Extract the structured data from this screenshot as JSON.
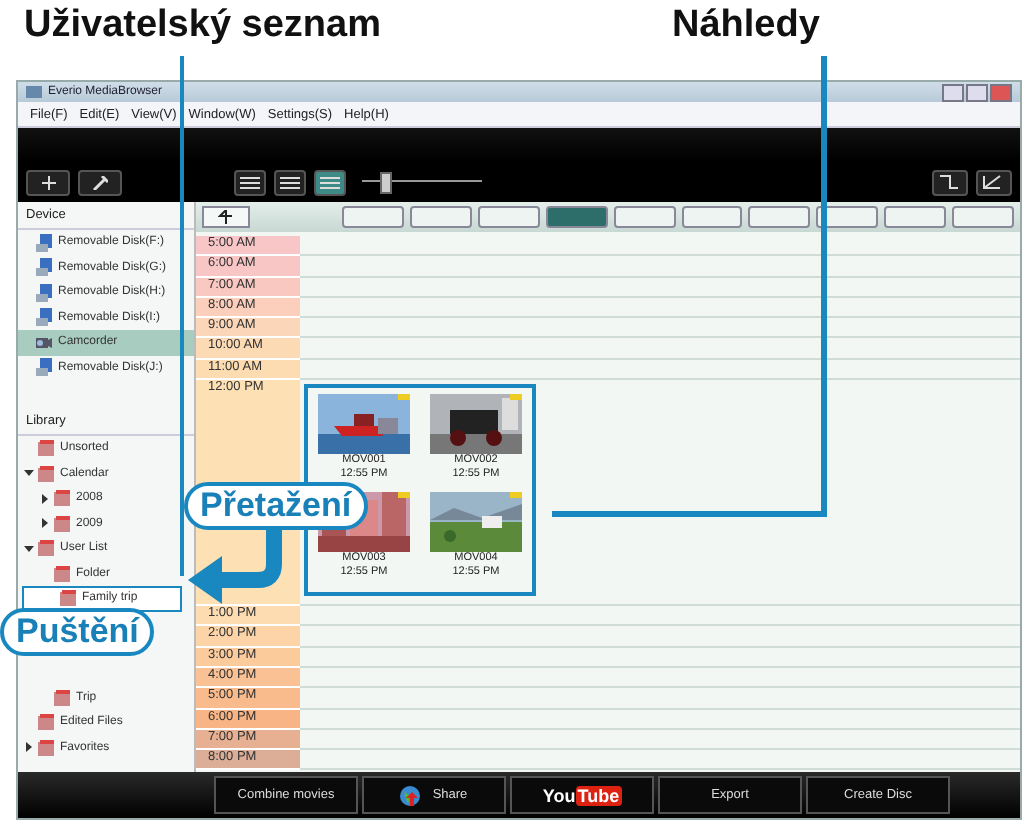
{
  "annotations": {
    "user_list_label": "Uživatelský seznam",
    "thumbnails_label": "Náhledy",
    "drag_label": "Přetažení",
    "drop_label": "Puštění"
  },
  "window": {
    "title": "Everio MediaBrowser"
  },
  "menu": [
    "File(F)",
    "Edit(E)",
    "View(V)",
    "Window(W)",
    "Settings(S)",
    "Help(H)"
  ],
  "view_modes": [
    {
      "selected": false
    },
    {
      "selected": false
    },
    {
      "selected": true
    }
  ],
  "zoom_slider": {
    "level": 0.15
  },
  "nav_buttons": [
    {
      "selected": false
    },
    {
      "selected": false
    },
    {
      "selected": false
    },
    {
      "selected": true
    },
    {
      "selected": false
    },
    {
      "selected": false
    },
    {
      "selected": false
    },
    {
      "selected": false
    },
    {
      "selected": false
    },
    {
      "selected": false
    }
  ],
  "sidebar": {
    "device_heading": "Device",
    "devices": [
      {
        "label": "Removable Disk(F:)",
        "kind": "disk",
        "selected": false
      },
      {
        "label": "Removable Disk(G:)",
        "kind": "disk",
        "selected": false
      },
      {
        "label": "Removable Disk(H:)",
        "kind": "disk",
        "selected": false
      },
      {
        "label": "Removable Disk(I:)",
        "kind": "disk",
        "selected": false
      },
      {
        "label": "Camcorder",
        "kind": "camcorder",
        "selected": true
      },
      {
        "label": "Removable Disk(J:)",
        "kind": "disk",
        "selected": false
      }
    ],
    "library_heading": "Library",
    "library": [
      {
        "label": "Unsorted"
      },
      {
        "label": "Calendar",
        "expanded": true,
        "children": [
          {
            "label": "2008",
            "expanded": false
          },
          {
            "label": "2009",
            "expanded": false
          }
        ]
      },
      {
        "label": "User List",
        "expanded": true,
        "children": [
          {
            "label": "Folder"
          },
          {
            "label": "Family trip",
            "highlighted": true
          },
          {
            "label": "Trip"
          }
        ]
      },
      {
        "label": "Edited Files"
      },
      {
        "label": "Favorites",
        "expanded": false
      }
    ]
  },
  "timeline": {
    "hours": [
      {
        "time": "5:00 AM",
        "color": "#f9c6c8"
      },
      {
        "time": "6:00 AM",
        "color": "#f9c6c6"
      },
      {
        "time": "7:00 AM",
        "color": "#f9c8c0"
      },
      {
        "time": "8:00 AM",
        "color": "#fbcfbc"
      },
      {
        "time": "9:00 AM",
        "color": "#fbd6b8"
      },
      {
        "time": "10:00 AM",
        "color": "#fcdab4"
      },
      {
        "time": "11:00 AM",
        "color": "#fcdcb0"
      },
      {
        "time": "12:00 PM",
        "color": "#fde0b4",
        "thumbnails": [
          {
            "name": "MOV001",
            "time": "12:55 PM"
          },
          {
            "name": "MOV002",
            "time": "12:55 PM"
          },
          {
            "name": "MOV003",
            "time": "12:55 PM"
          },
          {
            "name": "MOV004",
            "time": "12:55 PM"
          }
        ]
      },
      {
        "time": "1:00 PM",
        "color": "#fcdcb0"
      },
      {
        "time": "2:00 PM",
        "color": "#fcd4a8"
      },
      {
        "time": "3:00 PM",
        "color": "#fbcb9c"
      },
      {
        "time": "4:00 PM",
        "color": "#fac294"
      },
      {
        "time": "5:00 PM",
        "color": "#f9bb8c"
      },
      {
        "time": "6:00 PM",
        "color": "#f8b484"
      },
      {
        "time": "7:00 PM",
        "color": "#e8b092"
      },
      {
        "time": "8:00 PM",
        "color": "#dcae98"
      }
    ]
  },
  "bottom_buttons": [
    {
      "kind": "text",
      "label": "Combine movies"
    },
    {
      "kind": "share",
      "label": "Share"
    },
    {
      "kind": "logo",
      "parts": [
        "You",
        "Tube"
      ]
    },
    {
      "kind": "text",
      "label": "Export"
    },
    {
      "kind": "text",
      "label": "Create Disc"
    }
  ]
}
